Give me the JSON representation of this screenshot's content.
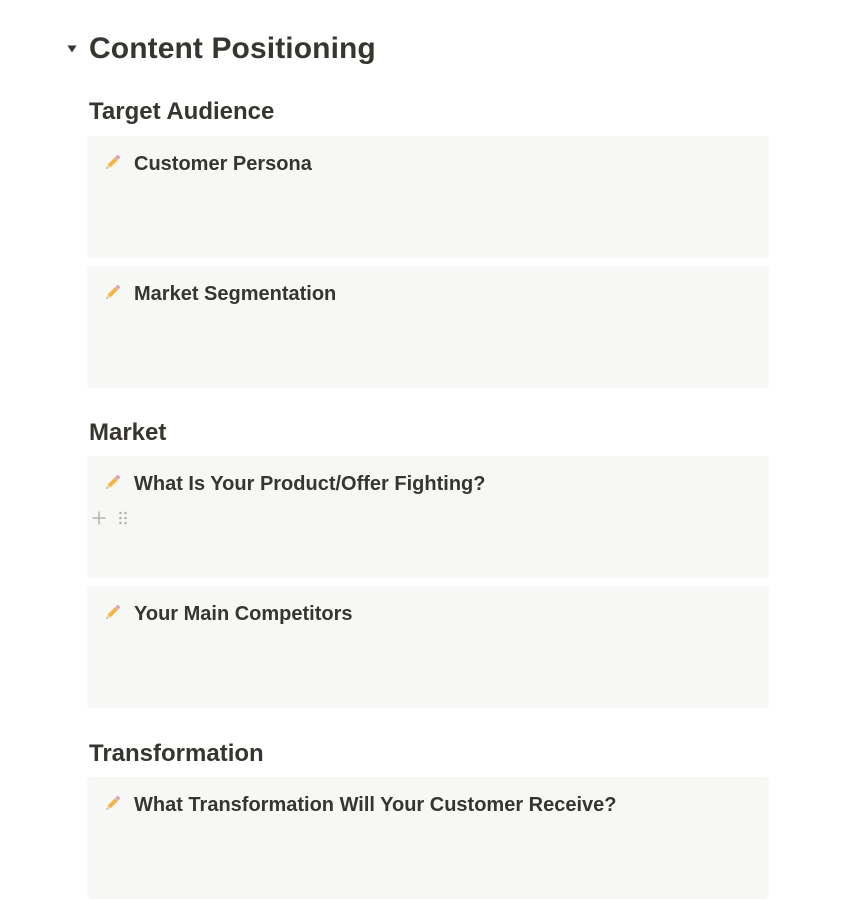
{
  "page": {
    "title": "Content Positioning",
    "toggle_icon": "triangle-down-icon"
  },
  "sections": [
    {
      "heading": "Target Audience",
      "callouts": [
        {
          "icon": "pencil-icon",
          "title": "Customer Persona"
        },
        {
          "icon": "pencil-icon",
          "title": "Market Segmentation"
        }
      ]
    },
    {
      "heading": "Market",
      "callouts": [
        {
          "icon": "pencil-icon",
          "title": "What Is Your Product/Offer Fighting?"
        },
        {
          "icon": "pencil-icon",
          "title": "Your Main Competitors"
        }
      ]
    },
    {
      "heading": "Transformation",
      "callouts": [
        {
          "icon": "pencil-icon",
          "title": "What Transformation Will Your Customer Receive?"
        }
      ]
    }
  ],
  "block_controls": {
    "add_icon": "plus-icon",
    "drag_icon": "drag-handle-icon"
  },
  "colors": {
    "text": "#37352f",
    "callout_bg": "#f7f7f5",
    "control_gray": "#b4b3af"
  }
}
